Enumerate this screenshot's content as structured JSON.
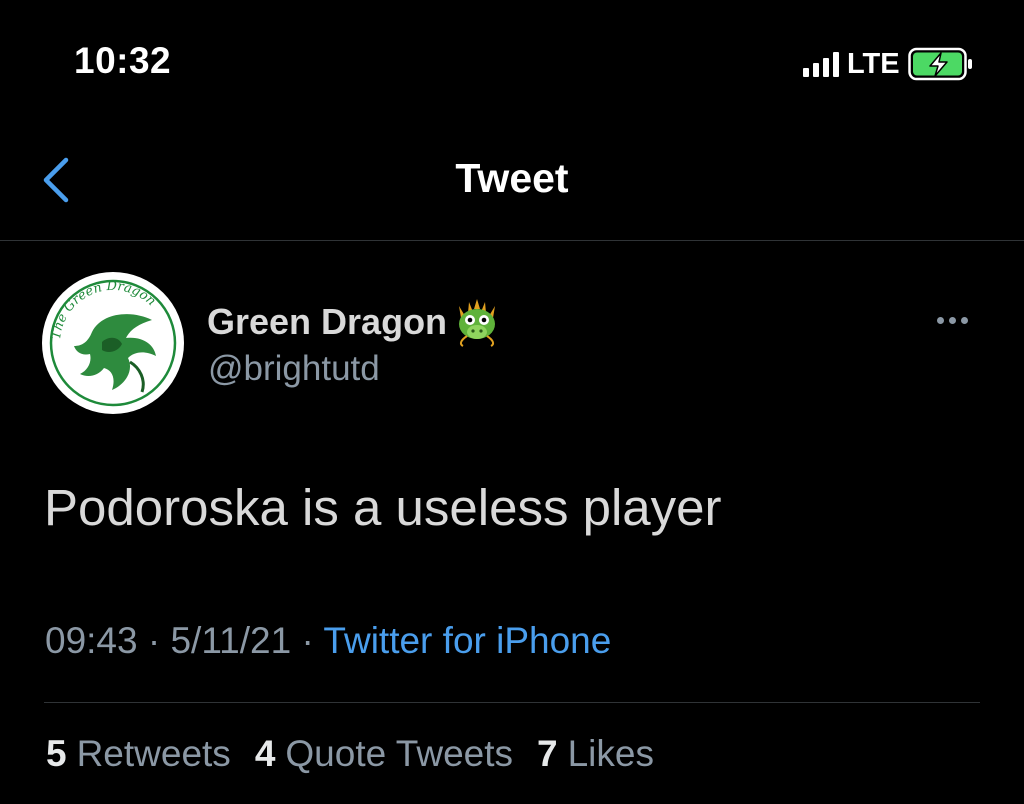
{
  "status_bar": {
    "time": "10:32",
    "network": "LTE",
    "battery_state": "charging",
    "battery_color": "#4cd964"
  },
  "nav": {
    "title": "Tweet",
    "back_icon": "chevron-left-icon",
    "accent_color": "#4a9eed"
  },
  "tweet": {
    "author": {
      "display_name": "Green Dragon",
      "name_emoji": "dragon-face-icon",
      "handle": "@brightutd",
      "avatar_text": "The Green Dragon"
    },
    "text": "Podoroska is a useless player",
    "time": "09:43",
    "separator": "·",
    "date": "5/11/21",
    "source": "Twitter for iPhone",
    "more_icon": "more-horizontal-icon"
  },
  "stats": {
    "retweets": {
      "count": "5",
      "label": "Retweets"
    },
    "quote_tweets": {
      "count": "4",
      "label": "Quote Tweets"
    },
    "likes": {
      "count": "7",
      "label": "Likes"
    }
  }
}
